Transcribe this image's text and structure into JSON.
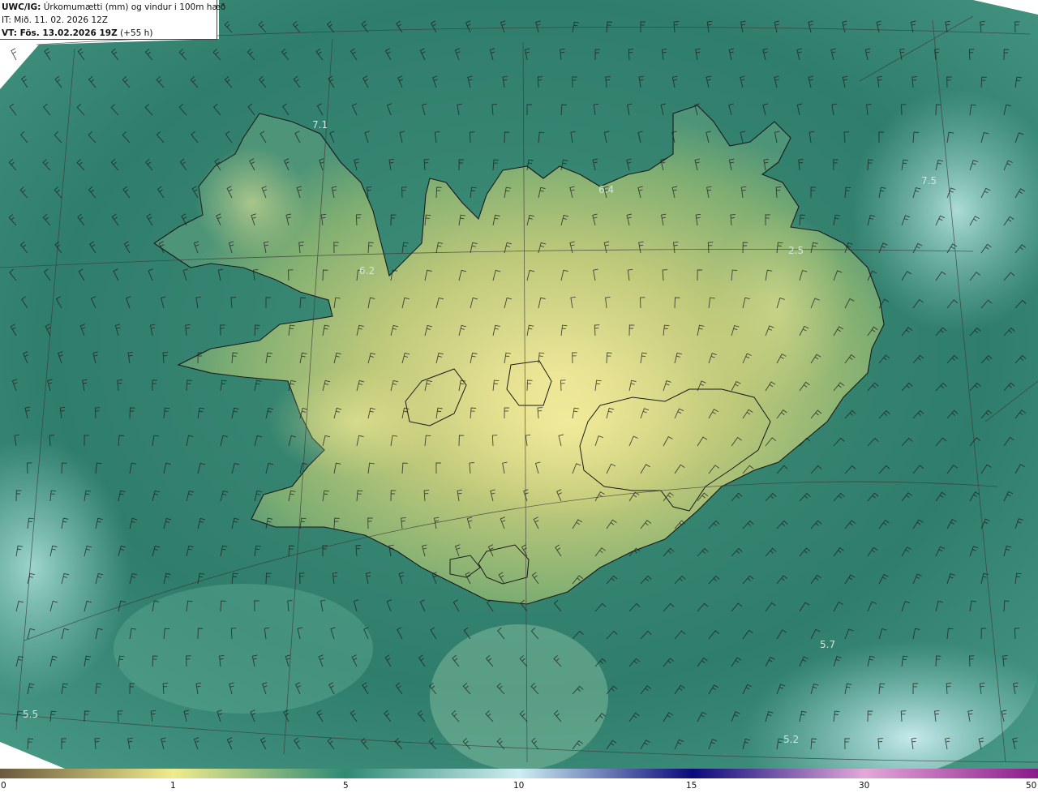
{
  "header": {
    "model": "UWC/IG:",
    "title": "Úrkomumætti (mm) og vindur i 100m hæð",
    "issue_time": "IT: Mið. 11. 02. 2026 12Z",
    "valid_prefix": "VT: Fös. 13.02.2026 19Z",
    "valid_suffix": "(+55 h)"
  },
  "colorbar": {
    "ticks": [
      {
        "label": "0",
        "value": 0
      },
      {
        "label": "1",
        "value": 1
      },
      {
        "label": "5",
        "value": 5
      },
      {
        "label": "10",
        "value": 10
      },
      {
        "label": "15",
        "value": 15
      },
      {
        "label": "30",
        "value": 30
      },
      {
        "label": "50",
        "value": 50
      }
    ],
    "colors": {
      "c0": "#6b5a3e",
      "c1": "#f0eb8c",
      "c5": "#2f8a74",
      "c10": "#cdeef2",
      "c15": "#0a0a7a",
      "c30": "#e3a8d8",
      "c50": "#8a1a8a"
    }
  },
  "map": {
    "colors": {
      "sea_dark": "#2e7a6a",
      "sea_light": "#7fc4b8",
      "land_low": "#6fa870",
      "land_high": "#e6df8a",
      "coast": "#1a1a1a",
      "grid": "#3a3a3a",
      "barb": "#1f1f1f"
    },
    "contour_labels": [
      {
        "text": "7.1"
      },
      {
        "text": "6.4"
      },
      {
        "text": "7.5"
      },
      {
        "text": "6.2"
      },
      {
        "text": "2.5"
      },
      {
        "text": "5.7"
      },
      {
        "text": "5.5"
      },
      {
        "text": "5.2"
      }
    ]
  }
}
